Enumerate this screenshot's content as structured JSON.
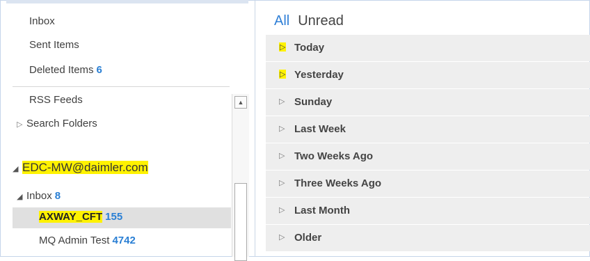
{
  "sidebar": {
    "folders_top": [
      {
        "label": "Inbox",
        "count": ""
      },
      {
        "label": "Sent Items",
        "count": ""
      },
      {
        "label": "Deleted Items",
        "count": "6"
      }
    ],
    "rss_label": "RSS Feeds",
    "search_folders_label": "Search Folders",
    "account_label": "EDC-MW@daimler.com",
    "inbox": {
      "label": "Inbox",
      "count": "8"
    },
    "subfolders": [
      {
        "label": "AXWAY_CFT",
        "count": "155",
        "selected": true
      },
      {
        "label": "MQ Admin Test",
        "count": "4742",
        "selected": false
      }
    ]
  },
  "filters": {
    "all": "All",
    "unread": "Unread"
  },
  "groups": [
    {
      "label": "Today",
      "highlighted": true
    },
    {
      "label": "Yesterday",
      "highlighted": true
    },
    {
      "label": "Sunday",
      "highlighted": false
    },
    {
      "label": "Last Week",
      "highlighted": false
    },
    {
      "label": "Two Weeks Ago",
      "highlighted": false
    },
    {
      "label": "Three Weeks Ago",
      "highlighted": false
    },
    {
      "label": "Last Month",
      "highlighted": false
    },
    {
      "label": "Older",
      "highlighted": false
    }
  ],
  "icons": {
    "expand": "triangle-right-icon",
    "collapse": "triangle-down-icon",
    "scroll_up": "arrow-up-icon"
  },
  "colors": {
    "accent": "#2f7fd6",
    "count": "#2a7fd4",
    "highlight": "#fff200",
    "group_bg": "#eeeeee"
  }
}
